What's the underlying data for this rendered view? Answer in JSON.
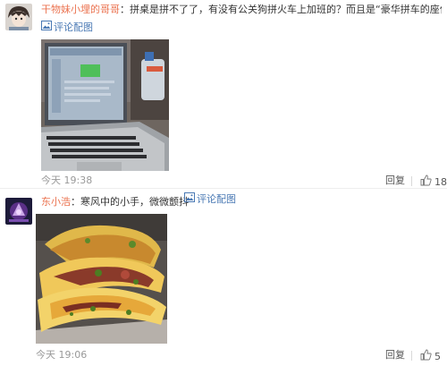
{
  "comments": [
    {
      "username": "干物妹小埋的哥哥",
      "separator": "：",
      "text": "拼桌是拼不了了，有没有公关狗拼火车上加班的？而且是“豪华拼车的座位”",
      "pic_link": "评论配图",
      "time": "今天 19:38",
      "reply": "回复",
      "likes": "18",
      "photo": "laptop-photo",
      "icons": {
        "pic": "image-icon",
        "like": "thumbs-up-icon"
      }
    },
    {
      "username": "东小浩",
      "separator": "：",
      "text": "寒风中的小手，微微颤抖",
      "pic_link": "评论配图",
      "time": "今天 19:06",
      "reply": "回复",
      "likes": "5",
      "photo": "pancake-photo",
      "icons": {
        "pic": "image-icon",
        "like": "thumbs-up-icon"
      }
    }
  ],
  "colors": {
    "username": "#eb7350",
    "link": "#4a79b4",
    "meta": "#999999"
  }
}
